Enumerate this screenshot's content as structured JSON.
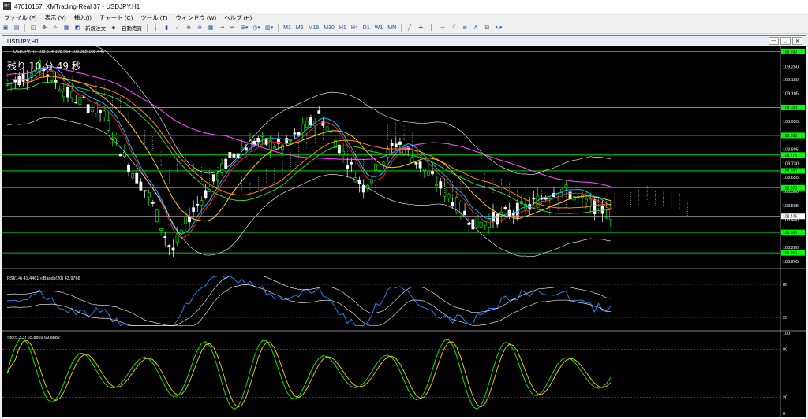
{
  "window": {
    "title": "47010157: XMTrading-Real 37 - USDJPY,H1",
    "icon": "mt4-icon"
  },
  "menu": [
    "ファイル (F)",
    "表示 (V)",
    "挿入(I)",
    "チャート (C)",
    "ツール (T)",
    "ウィンドウ (W)",
    "ヘルプ (H)"
  ],
  "toolbar": {
    "new_order": "新規注文",
    "auto_trading": "自動売買",
    "timeframes": [
      "M1",
      "M5",
      "M15",
      "M30",
      "H1",
      "H4",
      "D1",
      "W1",
      "MN"
    ],
    "text_tool": "A"
  },
  "chart": {
    "window_title": "USDJPY,H1",
    "header": "USDJPY,H1  108.514 108.564 108.385 108.446",
    "countdown": "残り 10 分 49 秒",
    "rsi_label": "RSI(14) 41.4461  ∞Bands(20) 43.9766",
    "stoch_label": "Sto(5,3,3) 65.8869 69.8882",
    "colors": {
      "bull": "#00ff00",
      "bear": "#ffffff",
      "rsi": "#1e90ff",
      "stoch_main": "#00ff00",
      "stoch_signal": "#ffd700",
      "level": "#00ff00"
    }
  },
  "chart_data": {
    "type": "candlestick",
    "symbol": "USDJPY",
    "timeframe": "H1",
    "price_axis": [
      "109.330",
      "109.250",
      "109.180",
      "109.105",
      "109.030",
      "108.955",
      "108.880",
      "108.805",
      "108.730",
      "108.655",
      "108.580",
      "108.505",
      "108.430",
      "108.355",
      "108.280",
      "108.205"
    ],
    "ylim": [
      108.2,
      109.34
    ],
    "horizontal_levels": [
      109.33,
      109.03,
      108.88,
      108.775,
      108.69,
      108.6,
      108.36,
      108.25
    ],
    "current_price": 108.446,
    "rsi": {
      "value": 41.4461,
      "levels": [
        20,
        80
      ],
      "axis": [
        "80",
        "20"
      ]
    },
    "stochastic": {
      "main": 65.8869,
      "signal": 69.8882,
      "axis": [
        "100",
        "80",
        "20",
        "0"
      ]
    }
  }
}
